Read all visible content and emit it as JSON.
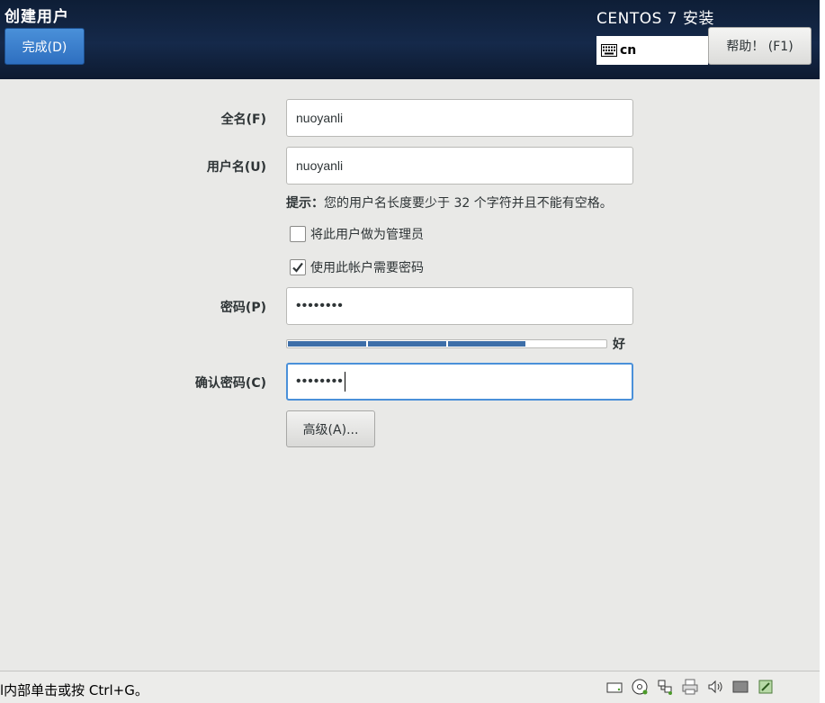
{
  "header": {
    "title": "创建用户",
    "done_label": "完成(D)",
    "product": "CENTOS 7 安装",
    "keyboard_layout": "cn",
    "help_label": "帮助！ (F1)"
  },
  "form": {
    "fullname_label": "全名(F)",
    "fullname_value": "nuoyanli",
    "username_label": "用户名(U)",
    "username_value": "nuoyanli",
    "hint_prefix": "提示：",
    "hint_text": "您的用户名长度要少于 32 个字符并且不能有空格。",
    "admin_label": "将此用户做为管理员",
    "admin_checked": false,
    "require_pw_label": "使用此帐户需要密码",
    "require_pw_checked": true,
    "password_label": "密码(P)",
    "password_value": "••••••••",
    "strength_label": "好",
    "strength_level": 0.75,
    "confirm_label": "确认密码(C)",
    "confirm_value": "••••••••",
    "advanced_label": "高级(A)..."
  },
  "status": {
    "text": "l内部单击或按 Ctrl+G。"
  },
  "colors": {
    "accent": "#4a90d9",
    "header_bg": "#13233f",
    "strength": "#3d6ea8"
  }
}
